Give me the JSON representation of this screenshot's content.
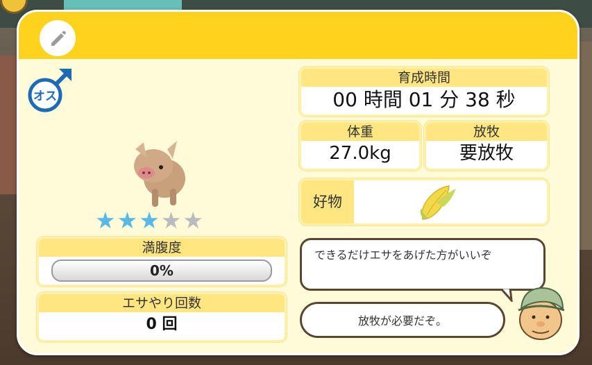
{
  "panel": {
    "edit_icon": "pencil-icon",
    "gender_icon": "male-symbol-icon",
    "gender_text": "オス",
    "rarity_stars": 3,
    "rarity_max": 5,
    "colors": {
      "header": "#ffd21e",
      "star_on": "#58b8e6",
      "star_off": "#b9bbbf"
    }
  },
  "stats": {
    "growth_time_label": "育成時間",
    "growth_time_value": "00 時間 01 分 38 秒",
    "weight_label": "体重",
    "weight_value": "27.0kg",
    "grazing_label": "放牧",
    "grazing_value": "要放牧",
    "favorite_label": "好物",
    "favorite_icon": "corn-icon",
    "fullness_label": "満腹度",
    "fullness_value": "0%",
    "feed_count_label": "エサやり回数",
    "feed_count_value": "0 回"
  },
  "advice": {
    "message1": "できるだけエサをあげた方がいいぞ",
    "message2": "放牧が必要だぞ。",
    "character_icon": "old-farmer-icon"
  }
}
